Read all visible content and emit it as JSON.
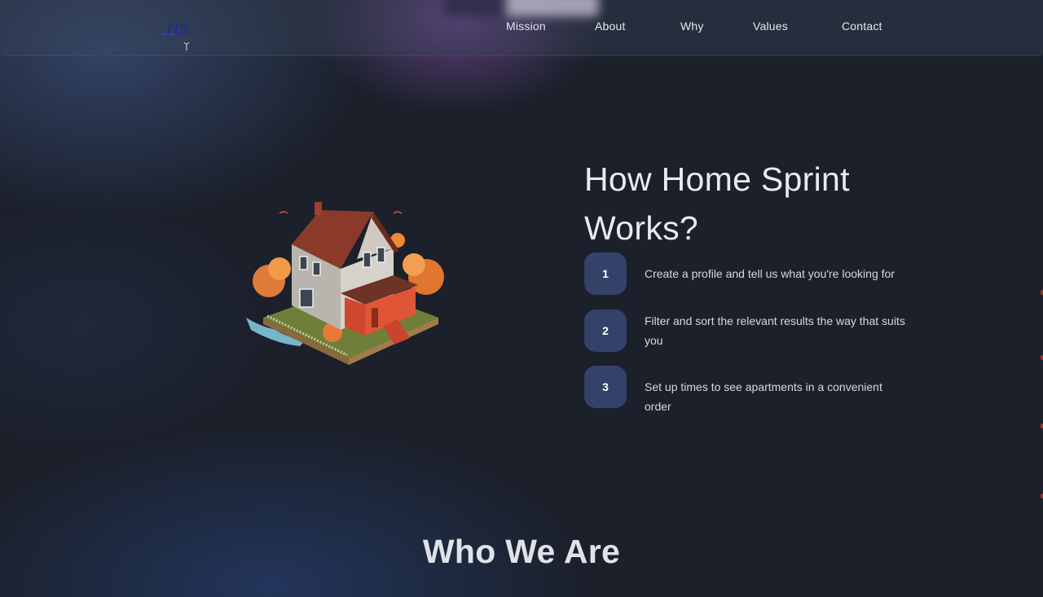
{
  "nav": {
    "logo": {
      "text": "HS",
      "icon": "hs-monogram-logo"
    },
    "links": [
      {
        "label": "Mission"
      },
      {
        "label": "About"
      },
      {
        "label": "Why"
      },
      {
        "label": "Values"
      },
      {
        "label": "Contact"
      }
    ]
  },
  "hero": {
    "image": "isometric-house-illustration",
    "heading_line1": "How Home Sprint",
    "heading_line2": "Works?",
    "steps": [
      {
        "number": "1",
        "text": "Create a profile and tell us what you're looking for"
      },
      {
        "number": "2",
        "text": "Filter and sort the relevant results the way that suits you"
      },
      {
        "number": "3",
        "text": "Set up times to see apartments in a convenient order"
      }
    ]
  },
  "who_we_are": {
    "title": "Who We Are"
  },
  "colors": {
    "background": "#1b202b",
    "step_badge": "#34426a",
    "accent_purple": "#9a5abe",
    "logo_blue": "#1a2a9c"
  }
}
